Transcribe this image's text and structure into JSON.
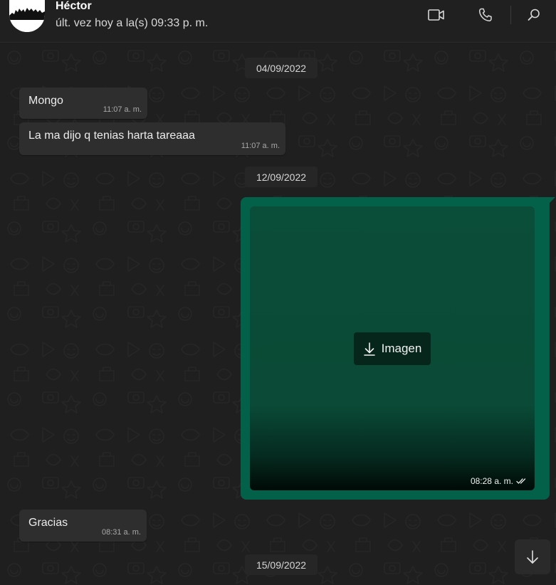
{
  "header": {
    "name": "Héctor",
    "status": "últ. vez hoy a la(s) 09:33 p. m.",
    "icons": [
      "video-call-icon",
      "voice-call-icon",
      "search-icon"
    ]
  },
  "dates": {
    "d1": "04/09/2022",
    "d2": "12/09/2022",
    "d3": "15/09/2022"
  },
  "messages": [
    {
      "text": "Mongo",
      "time": "11:07 a. m.",
      "direction": "incoming"
    },
    {
      "text": "La ma dijo q tenias harta tareaaa",
      "time": "11:07 a. m.",
      "direction": "incoming"
    },
    {
      "type": "image",
      "label": "Imagen",
      "time": "08:28 a. m.",
      "direction": "outgoing",
      "status": "delivered"
    },
    {
      "text": "Gracias",
      "time": "08:31 a. m.",
      "direction": "incoming"
    }
  ],
  "colors": {
    "outgoing_bubble": "#046149",
    "incoming_bubble": "#2e2e2e",
    "header_bg": "#202020",
    "chat_bg": "#1f1f1f"
  }
}
